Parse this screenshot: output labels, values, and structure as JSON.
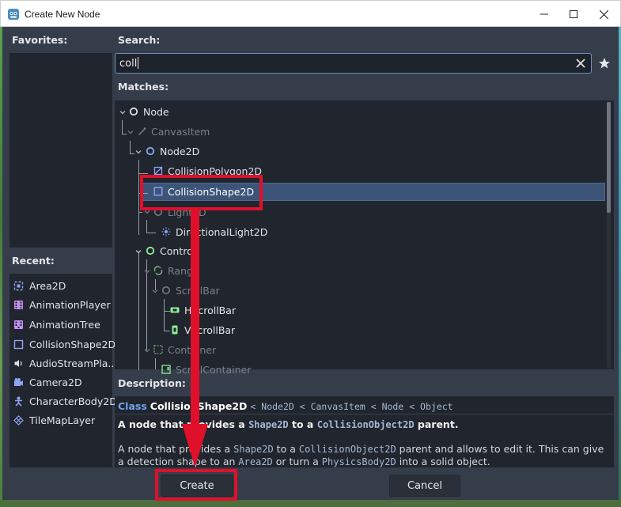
{
  "window": {
    "title": "Create New Node"
  },
  "favorites": {
    "header": "Favorites:"
  },
  "recent": {
    "header": "Recent:",
    "items": [
      {
        "label": "Area2D",
        "icon": "area2d-icon"
      },
      {
        "label": "AnimationPlayer",
        "icon": "animation-player-icon"
      },
      {
        "label": "AnimationTree",
        "icon": "animation-tree-icon"
      },
      {
        "label": "CollisionShape2D",
        "icon": "collision-shape-icon"
      },
      {
        "label": "AudioStreamPla...",
        "icon": "audio-stream-icon"
      },
      {
        "label": "Camera2D",
        "icon": "camera2d-icon"
      },
      {
        "label": "CharacterBody2D",
        "icon": "character-body-icon"
      },
      {
        "label": "TileMapLayer",
        "icon": "tilemap-layer-icon"
      }
    ]
  },
  "search": {
    "header": "Search:",
    "value": "coll"
  },
  "matches": {
    "header": "Matches:",
    "nodes": [
      {
        "label": "Node",
        "icon": "node-icon"
      },
      {
        "label": "CanvasItem",
        "icon": "canvasitem-icon"
      },
      {
        "label": "Node2D",
        "icon": "node2d-icon"
      },
      {
        "label": "CollisionPolygon2D",
        "icon": "collision-polygon-icon"
      },
      {
        "label": "CollisionShape2D",
        "icon": "collision-shape-icon"
      },
      {
        "label": "Light2D",
        "icon": "light2d-icon"
      },
      {
        "label": "DirectionalLight2D",
        "icon": "directional-light-icon"
      },
      {
        "label": "Control",
        "icon": "control-icon"
      },
      {
        "label": "Range",
        "icon": "range-icon"
      },
      {
        "label": "ScrollBar",
        "icon": "scrollbar-icon"
      },
      {
        "label": "HScrollBar",
        "icon": "hscrollbar-icon"
      },
      {
        "label": "VScrollBar",
        "icon": "vscrollbar-icon"
      },
      {
        "label": "Container",
        "icon": "container-icon"
      },
      {
        "label": "ScrollContainer",
        "icon": "scroll-container-icon"
      }
    ],
    "selected": "CollisionShape2D"
  },
  "description": {
    "header": "Description:",
    "class_keyword": "Class",
    "class_name": "CollisionShape2D",
    "inheritance": "< Node2D < CanvasItem < Node < Object",
    "brief_parts": [
      "A node that provides a ",
      "Shape2D",
      " to a ",
      "CollisionObject2D",
      " parent."
    ],
    "full_parts": [
      "A node that provides a ",
      "Shape2D",
      " to a ",
      "CollisionObject2D",
      " parent and allows to edit it. This can give a detection shape to an ",
      "Area2D",
      " or turn a ",
      "PhysicsBody2D",
      " into a solid object."
    ]
  },
  "buttons": {
    "create": "Create",
    "cancel": "Cancel"
  },
  "colors": {
    "accent": "#6ea3ec",
    "selection": "#3c5478",
    "annotation": "#e0102a"
  }
}
